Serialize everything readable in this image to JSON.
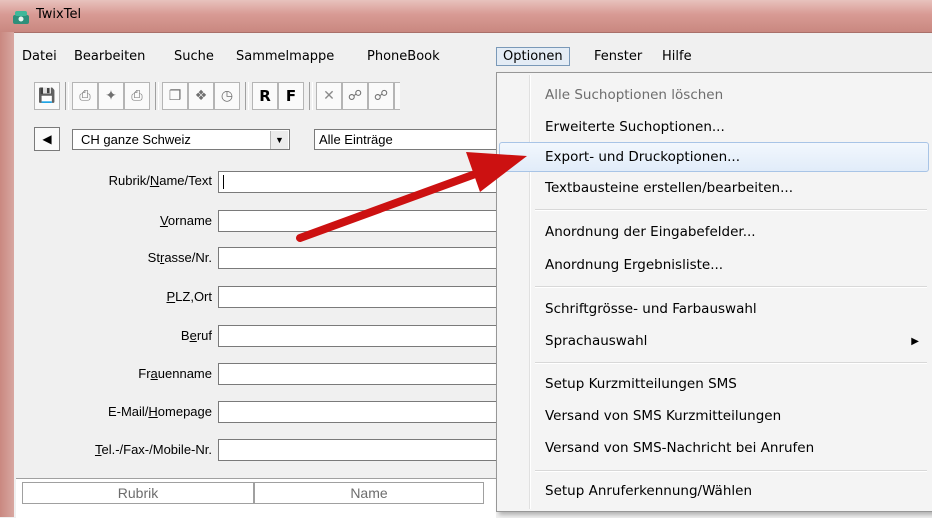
{
  "window": {
    "title": "TwixTel"
  },
  "menubar": {
    "items": [
      "Datei",
      "Bearbeiten",
      "Suche",
      "Sammelmappe",
      "PhoneBook",
      "Optionen",
      "Fenster",
      "Hilfe"
    ]
  },
  "toolbar": {
    "r_label": "R",
    "f_label": "F"
  },
  "selectors": {
    "region": "CH ganze Schweiz",
    "entries": "Alle Einträge"
  },
  "form": {
    "fields": [
      {
        "pre": "Rubrik/",
        "acc": "N",
        "post": "ame/Text"
      },
      {
        "pre": "",
        "acc": "V",
        "post": "orname"
      },
      {
        "pre": "St",
        "acc": "r",
        "post": "asse/Nr."
      },
      {
        "pre": "",
        "acc": "P",
        "post": "LZ,Ort"
      },
      {
        "pre": "B",
        "acc": "e",
        "post": "ruf"
      },
      {
        "pre": "Fr",
        "acc": "a",
        "post": "uenname"
      },
      {
        "pre": "E-Mail/",
        "acc": "H",
        "post": "omepage"
      },
      {
        "pre": "",
        "acc": "T",
        "post": "el.-/Fax-/Mobile-Nr."
      }
    ]
  },
  "results": {
    "columns": [
      "Rubrik",
      "Name"
    ]
  },
  "dropdown": {
    "items": [
      "Alle Suchoptionen löschen",
      "Erweiterte Suchoptionen...",
      "Export- und Druckoptionen...",
      "Textbausteine erstellen/bearbeiten...",
      "Anordnung der Eingabefelder...",
      "Anordnung Ergebnisliste...",
      "Schriftgrösse- und Farbauswahl",
      "Sprachauswahl",
      "Setup Kurzmitteilungen SMS",
      "Versand von SMS Kurzmitteilungen",
      "Versand von SMS-Nachricht bei Anrufen",
      "Setup Anruferkennung/Wählen"
    ]
  },
  "colors": {
    "arrow": "#cc1111",
    "highlight_border": "#a8c4e6",
    "titlebar": "#d89a94"
  }
}
